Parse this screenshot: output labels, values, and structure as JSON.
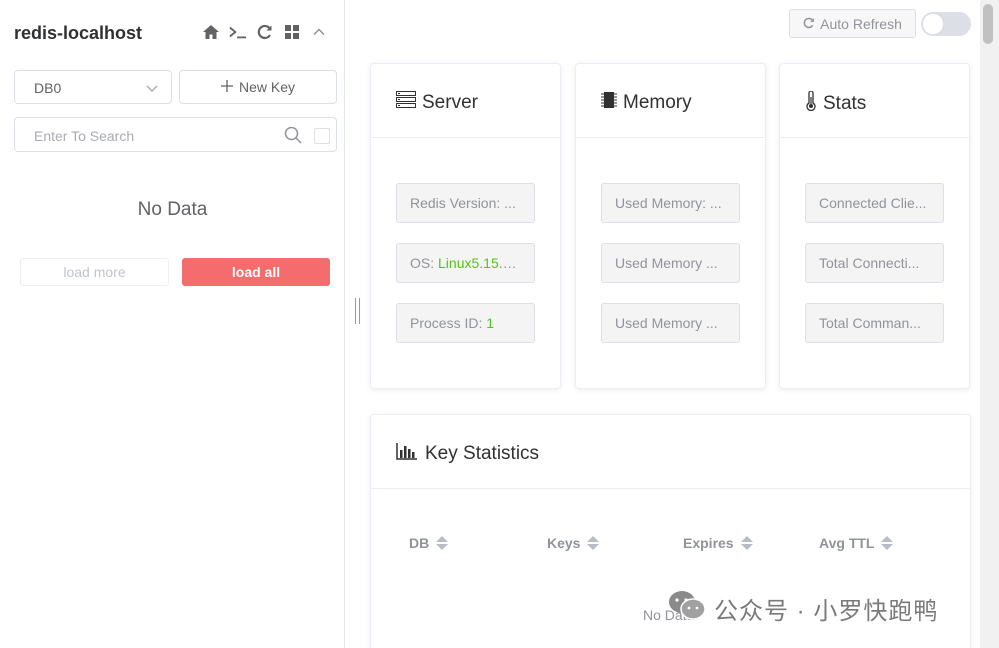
{
  "connection": {
    "title": "redis-localhost",
    "actions": [
      "home-icon",
      "terminal-icon",
      "refresh-icon",
      "grid-icon",
      "collapse-icon"
    ]
  },
  "db_select": {
    "value": "DB0"
  },
  "new_key_label": "New Key",
  "search": {
    "placeholder": "Enter To Search"
  },
  "left_empty": "No Data",
  "load_more_label": "load more",
  "load_all_label": "load all",
  "auto_refresh_label": "Auto Refresh",
  "auto_refresh_on": false,
  "server": {
    "title": "Server",
    "rows": [
      {
        "label": "Redis Version: ...",
        "value": ""
      },
      {
        "label": "OS: ",
        "value": "Linux5.15.1..."
      },
      {
        "label": "Process ID: ",
        "value": "1"
      }
    ]
  },
  "memory": {
    "title": "Memory",
    "rows": [
      {
        "label": "Used Memory: ...",
        "value": ""
      },
      {
        "label": "Used Memory ...",
        "value": ""
      },
      {
        "label": "Used Memory ...",
        "value": ""
      }
    ]
  },
  "stats": {
    "title": "Stats",
    "rows": [
      {
        "label": "Connected Clie...",
        "value": ""
      },
      {
        "label": "Total Connecti...",
        "value": ""
      },
      {
        "label": "Total Comman...",
        "value": ""
      }
    ]
  },
  "key_statistics": {
    "title": "Key Statistics",
    "columns": [
      "DB",
      "Keys",
      "Expires",
      "Avg TTL"
    ],
    "empty": "No Data"
  },
  "watermark": "公众号 · 小罗快跑鸭",
  "colors": {
    "accent_red": "#f56c6c",
    "value_green": "#52c41a"
  }
}
